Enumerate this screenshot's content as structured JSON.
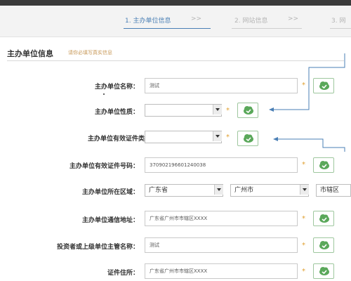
{
  "steps": [
    {
      "label": "1. 主办单位信息",
      "sep": ">>"
    },
    {
      "label": "2. 网站信息",
      "sep": ">>"
    },
    {
      "label": "3. 网"
    }
  ],
  "section": {
    "title": "主办单位信息",
    "note": "请你必填写真实信息"
  },
  "fields": {
    "org_name": {
      "label": "主办单位名称：",
      "value": "测试"
    },
    "org_nature": {
      "label": "主办单位性质：",
      "value": ""
    },
    "cert_type": {
      "label": "主办单位有效证件类型：",
      "value": ""
    },
    "cert_number": {
      "label": "主办单位有效证件号码：",
      "value": "370902196601240038"
    },
    "region": {
      "label": "主办单位所在区域：",
      "province": "广东省",
      "city": "广州市",
      "district": "市辖区"
    },
    "address": {
      "label": "主办单位通信地址：",
      "value": "广东省广州市市辖区XXXX"
    },
    "investor": {
      "label": "投资者或上级单位主管名称：",
      "value": "测试"
    },
    "cert_address": {
      "label": "证件住所：",
      "value": "广东省广州市市辖区XXXX"
    }
  },
  "required_mark": "*",
  "icons": {
    "valid": "check-cloud-icon"
  },
  "colors": {
    "step_active": "#4a7fb5",
    "valid_green": "#5aa85a",
    "required": "#e0a030",
    "arrow": "#4a7fb5"
  }
}
